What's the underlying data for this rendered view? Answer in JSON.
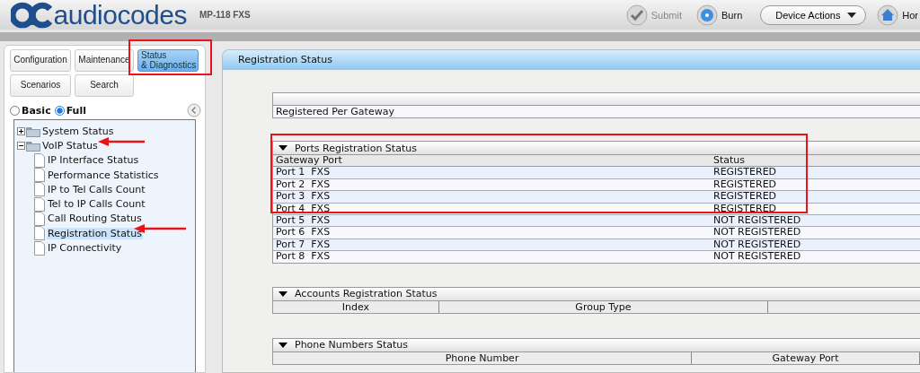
{
  "header": {
    "logo": "audiocodes",
    "device": "MP-118 FXS",
    "actions": [
      {
        "kind": "submit",
        "label": "Submit",
        "disabled": true
      },
      {
        "kind": "burn",
        "label": "Burn",
        "disabled": false
      }
    ],
    "dropdown": "Device Actions",
    "home": "Hor"
  },
  "nav_tabs": [
    {
      "label": "Configuration",
      "selected": false
    },
    {
      "label": "Maintenance",
      "selected": false
    },
    {
      "label": "Status\n& Diagnostics",
      "selected": true
    },
    {
      "label": "Scenarios",
      "selected": false
    },
    {
      "label": "Search",
      "selected": false
    }
  ],
  "view_mode": [
    {
      "label": "Basic",
      "selected": false
    },
    {
      "label": "Full",
      "selected": true
    }
  ],
  "tree": [
    {
      "label": "System Status",
      "expanded": false,
      "selected": false
    },
    {
      "label": "VoIP Status",
      "expanded": true,
      "selected": false,
      "children": [
        {
          "label": "IP Interface Status",
          "selected": false
        },
        {
          "label": "Performance Statistics",
          "selected": false
        },
        {
          "label": "IP to Tel Calls Count",
          "selected": false
        },
        {
          "label": "Tel to IP Calls Count",
          "selected": false
        },
        {
          "label": "Call Routing Status",
          "selected": false
        },
        {
          "label": "Registration Status",
          "selected": true
        },
        {
          "label": "IP Connectivity",
          "selected": false
        }
      ]
    }
  ],
  "panel": {
    "title": "Registration Status",
    "gateway_table": {
      "rows": [
        "Registered Per Gateway"
      ]
    },
    "ports": {
      "title": "Ports Registration Status",
      "columns": [
        "Gateway Port",
        "Status"
      ],
      "rows": [
        [
          "Port 1  FXS",
          "REGISTERED"
        ],
        [
          "Port 2  FXS",
          "REGISTERED"
        ],
        [
          "Port 3  FXS",
          "REGISTERED"
        ],
        [
          "Port 4  FXS",
          "REGISTERED"
        ],
        [
          "Port 5  FXS",
          "NOT REGISTERED"
        ],
        [
          "Port 6  FXS",
          "NOT REGISTERED"
        ],
        [
          "Port 7  FXS",
          "NOT REGISTERED"
        ],
        [
          "Port 8  FXS",
          "NOT REGISTERED"
        ]
      ]
    },
    "accounts": {
      "title": "Accounts Registration Status",
      "columns": [
        "Index",
        "Group Type"
      ]
    },
    "phones": {
      "title": "Phone Numbers Status",
      "columns": [
        "Phone Number",
        "Gateway Port"
      ]
    }
  }
}
